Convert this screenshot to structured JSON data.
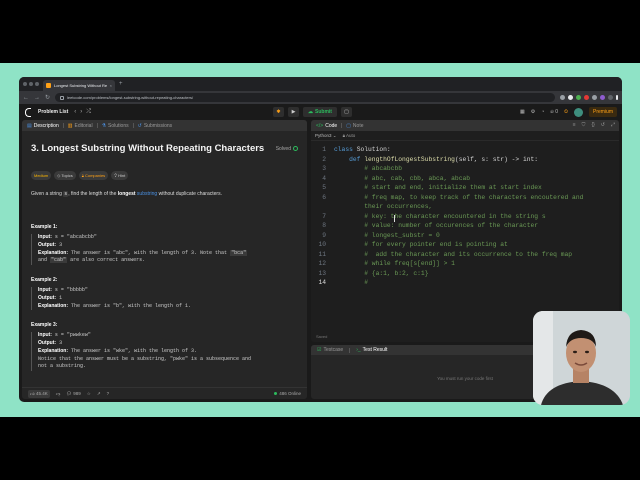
{
  "browser": {
    "tab_title": "Longest Substring Without Re...",
    "tab_close": "×",
    "new_tab": "+",
    "url": "leetcode.com/problems/longest-substring-without-repeating-characters/",
    "nav_icons": [
      "back-arrow",
      "forward-arrow",
      "reload"
    ]
  },
  "header": {
    "problem_list": "Problem List",
    "submit": "Submit",
    "premium": "Premium",
    "streak": "0"
  },
  "left_tabs": [
    {
      "label": "Description",
      "icon": "document-icon"
    },
    {
      "label": "Editorial",
      "icon": "book-icon"
    },
    {
      "label": "Solutions",
      "icon": "flask-icon"
    },
    {
      "label": "Submissions",
      "icon": "history-icon"
    }
  ],
  "problem": {
    "title": "3. Longest Substring Without Repeating Characters",
    "solved": "Solved",
    "tags": [
      "Medium",
      "Topics",
      "Companies",
      "Hint"
    ],
    "desc_1": "Given a string ",
    "desc_code": "s",
    "desc_2": ", find the length of the ",
    "desc_bold": "longest",
    "desc_link": "substring",
    "desc_3": " without duplicate characters."
  },
  "examples": [
    {
      "heading": "Example 1:",
      "input_label": "Input:",
      "input": "s = \"abcabcbb\"",
      "output_label": "Output:",
      "output": "3",
      "expl_label": "Explanation:",
      "expl": "The answer is \"abc\", with the length of 3. Note that",
      "expl_code1": "\"bca\"",
      "expl_and": "and",
      "expl_code2": "\"cab\"",
      "expl_tail": "are also correct answers."
    },
    {
      "heading": "Example 2:",
      "input_label": "Input:",
      "input": "s = \"bbbbb\"",
      "output_label": "Output:",
      "output": "1",
      "expl_label": "Explanation:",
      "expl": "The answer is \"b\", with the length of 1."
    },
    {
      "heading": "Example 3:",
      "input_label": "Input:",
      "input": "s = \"pwwkew\"",
      "output_label": "Output:",
      "output": "3",
      "expl_label": "Explanation:",
      "expl": "The answer is \"wke\", with the length of 3.",
      "expl_2": "Notice that the answer must be a substring, \"pwke\" is a subsequence and",
      "expl_3": "not a substring."
    }
  ],
  "footer": {
    "likes": "45.4K",
    "comments": "989",
    "online": "486 Online"
  },
  "editor": {
    "tabs": [
      {
        "label": "Code"
      },
      {
        "label": "Note"
      }
    ],
    "language": "Python3",
    "autocomplete": "Auto",
    "saved": "Saved",
    "lines": [
      {
        "n": "1",
        "parts": [
          [
            "kw",
            "class "
          ],
          [
            "ct",
            "Solution:"
          ]
        ]
      },
      {
        "n": "2",
        "parts": [
          [
            "ct",
            "    "
          ],
          [
            "kw",
            "def "
          ],
          [
            "fn",
            "lengthOfLongestSubstring"
          ],
          [
            "ct",
            "(self, s: str) -> int:"
          ]
        ]
      },
      {
        "n": "3",
        "parts": [
          [
            "cm",
            "        # abcabcbb"
          ]
        ]
      },
      {
        "n": "4",
        "parts": [
          [
            "cm",
            "        # abc, cab, cbb, abca, abcab"
          ]
        ]
      },
      {
        "n": "5",
        "parts": [
          [
            "cm",
            "        # start and end, initialize them at start index"
          ]
        ]
      },
      {
        "n": "6",
        "parts": [
          [
            "cm",
            "        # freq map, to keep track of the characters encoutered and"
          ]
        ]
      },
      {
        "n": "",
        "parts": [
          [
            "cm",
            "        their occurrences,"
          ]
        ]
      },
      {
        "n": "7",
        "parts": [
          [
            "cm",
            "        # key: the character encountered in the string s"
          ]
        ]
      },
      {
        "n": "8",
        "parts": [
          [
            "cm",
            "        # value: number of occurences of the character"
          ]
        ]
      },
      {
        "n": "9",
        "parts": [
          [
            "cm",
            "        # longest_substr = 0"
          ]
        ]
      },
      {
        "n": "10",
        "parts": [
          [
            "cm",
            "        # for every pointer end is pointing at"
          ]
        ]
      },
      {
        "n": "11",
        "parts": [
          [
            "cm",
            "        #  add the character and its occurrence to the freq map"
          ]
        ]
      },
      {
        "n": "12",
        "parts": [
          [
            "cm",
            "        # while freq[s[end]] > 1"
          ]
        ]
      },
      {
        "n": "13",
        "parts": [
          [
            "cm",
            "        # {a:1, b:2, c:1}"
          ]
        ]
      },
      {
        "n": "14",
        "parts": [
          [
            "cm",
            "        #"
          ]
        ]
      }
    ]
  },
  "testpanel": {
    "tabs": [
      {
        "label": "Testcase"
      },
      {
        "label": "Test Result"
      }
    ],
    "message": "You must run your code first"
  }
}
